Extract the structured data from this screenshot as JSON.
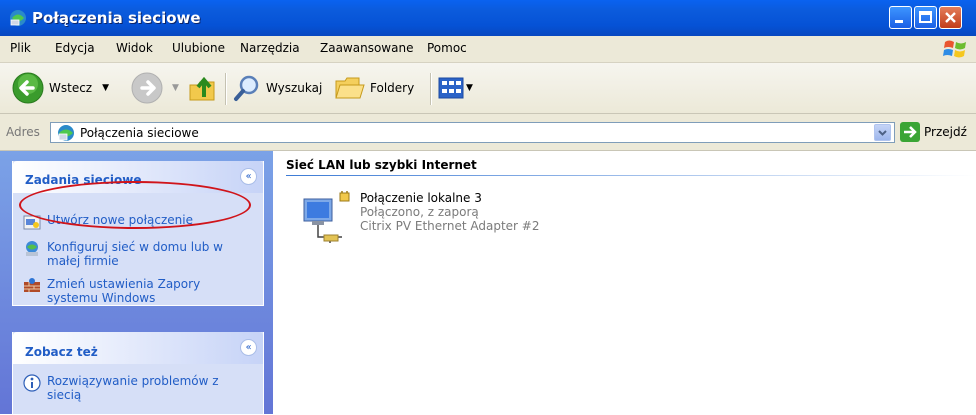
{
  "window": {
    "title": "Połączenia sieciowe"
  },
  "menu": [
    "Plik",
    "Edycja",
    "Widok",
    "Ulubione",
    "Narzędzia",
    "Zaawansowane",
    "Pomoc"
  ],
  "toolbar": {
    "back_label": "Wstecz",
    "search_label": "Wyszukaj",
    "folders_label": "Foldery"
  },
  "address": {
    "label": "Adres",
    "value": "Połączenia sieciowe",
    "go_label": "Przejdź"
  },
  "tasks_panel": {
    "title": "Zadania sieciowe",
    "items": [
      "Utwórz nowe połączenie",
      "Konfiguruj sieć w domu lub w małej firmie",
      "Zmień ustawienia Zapory systemu Windows"
    ]
  },
  "see_also_panel": {
    "title": "Zobacz też",
    "items": [
      "Rozwiązywanie problemów z siecią"
    ]
  },
  "content": {
    "group_header": "Sieć LAN lub szybki Internet",
    "connection": {
      "name": "Połączenie lokalne 3",
      "status": "Połączono, z zaporą",
      "device": "Citrix PV Ethernet Adapter #2"
    }
  },
  "colors": {
    "title_bar": "#0a5ee6",
    "task_link": "#215dc6",
    "highlight_circle": "#d0141a",
    "pane_bg": "#7ba2e7"
  }
}
